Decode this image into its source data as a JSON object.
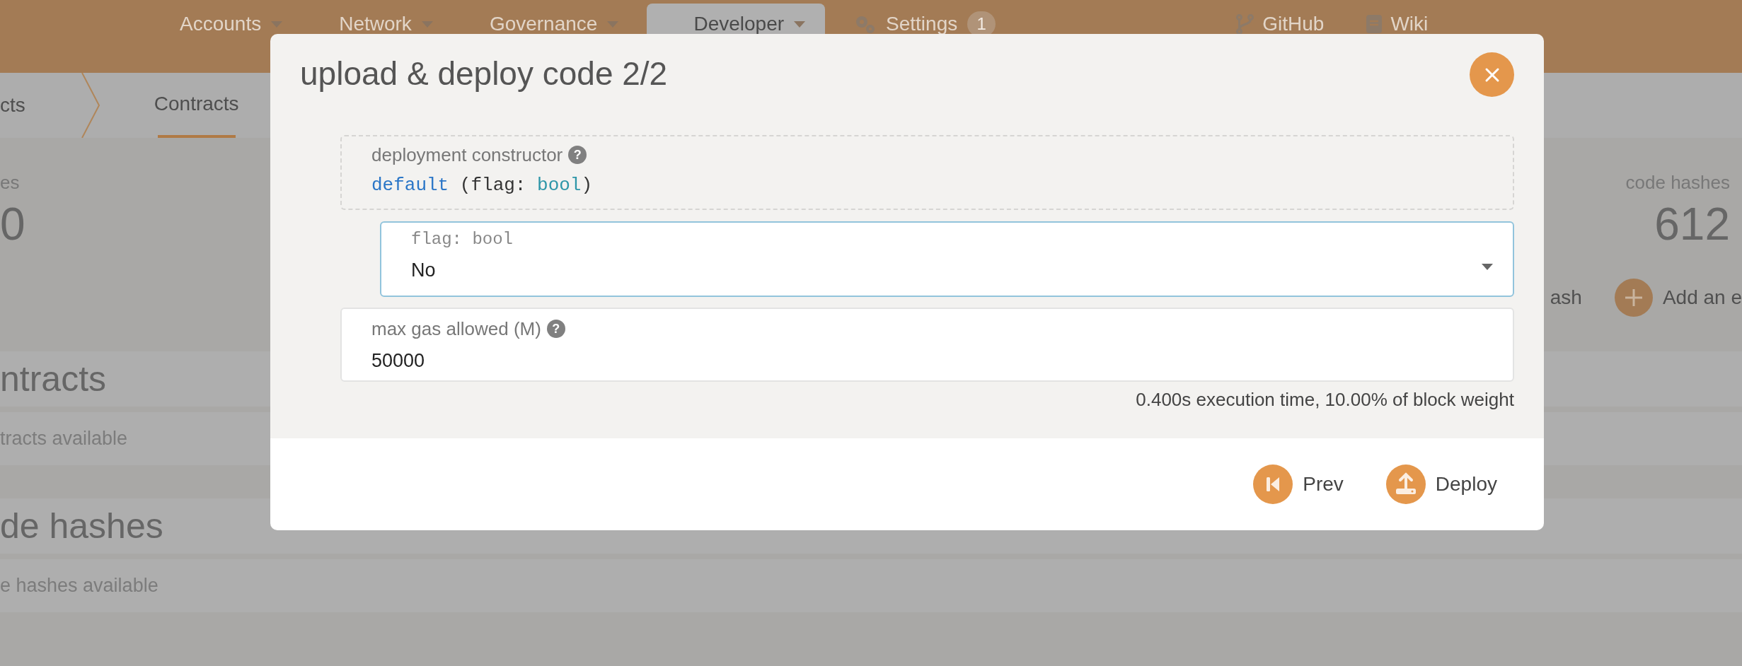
{
  "nav": {
    "items": [
      {
        "label": "Accounts",
        "kind": "menu",
        "selected": false
      },
      {
        "label": "Network",
        "kind": "menu",
        "selected": false
      },
      {
        "label": "Governance",
        "kind": "menu",
        "selected": false
      },
      {
        "label": "Developer",
        "kind": "menu",
        "selected": true
      },
      {
        "label": "Settings",
        "kind": "settings",
        "selected": false,
        "badge": "1"
      }
    ],
    "links": [
      {
        "label": "GitHub",
        "kind": "repo"
      },
      {
        "label": "Wiki",
        "kind": "docs"
      }
    ]
  },
  "subnav": {
    "crumb": "cts",
    "tabs": [
      {
        "label": "Contracts",
        "selected": true
      }
    ]
  },
  "summary": {
    "left": {
      "label": "es",
      "value": "0"
    },
    "right": {
      "label": "code hashes",
      "value": "612"
    },
    "actions": [
      {
        "label": "ash",
        "kind": "text"
      },
      {
        "label": "Add an e",
        "kind": "add"
      }
    ]
  },
  "sections": [
    {
      "title": "ntracts",
      "empty": "tracts available"
    },
    {
      "title": "de hashes",
      "empty": "e hashes available"
    }
  ],
  "modal": {
    "title": "upload & deploy code 2/2",
    "constructor": {
      "label": "deployment constructor",
      "help": "?",
      "parts": [
        {
          "text": "default",
          "kind": "name"
        },
        {
          "text": " (flag: ",
          "kind": "plain"
        },
        {
          "text": "bool",
          "kind": "type"
        },
        {
          "text": ")",
          "kind": "plain"
        }
      ]
    },
    "param_field": {
      "label": "flag: bool",
      "value": "No"
    },
    "gas_field": {
      "label": "max gas allowed (M)",
      "help": "?",
      "value": "50000"
    },
    "note": "0.400s execution time, 10.00% of block weight",
    "buttons": [
      {
        "label": "Prev",
        "kind": "prev"
      },
      {
        "label": "Deploy",
        "kind": "deploy"
      }
    ]
  }
}
